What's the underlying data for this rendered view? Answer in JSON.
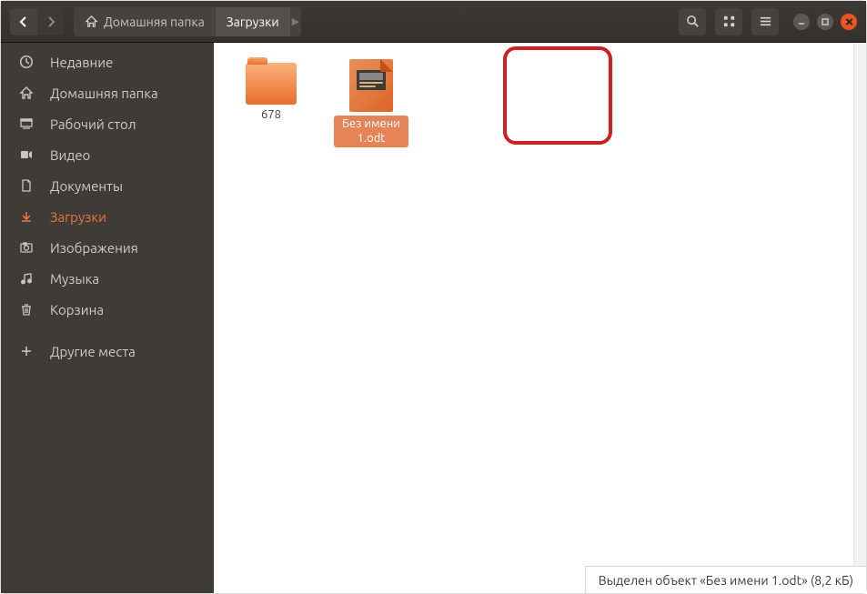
{
  "breadcrumb": {
    "home_label": "Домашняя папка",
    "current_label": "Загрузки"
  },
  "sidebar": {
    "items": [
      {
        "icon": "recent-icon",
        "label": "Недавние"
      },
      {
        "icon": "home-icon",
        "label": "Домашняя папка"
      },
      {
        "icon": "desktop-icon",
        "label": "Рабочий стол"
      },
      {
        "icon": "video-icon",
        "label": "Видео"
      },
      {
        "icon": "documents-icon",
        "label": "Документы"
      },
      {
        "icon": "downloads-icon",
        "label": "Загрузки",
        "active": true
      },
      {
        "icon": "pictures-icon",
        "label": "Изображения"
      },
      {
        "icon": "music-icon",
        "label": "Музыка"
      },
      {
        "icon": "trash-icon",
        "label": "Корзина"
      }
    ],
    "other_places_label": "Другие места"
  },
  "files": {
    "folder_name": "678",
    "selected_file": "Без имени 1.odt"
  },
  "status": {
    "text": "Выделен объект «Без имени 1.odt»  (8,2 кБ)"
  }
}
